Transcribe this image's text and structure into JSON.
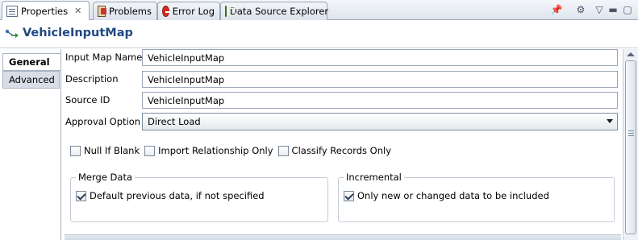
{
  "tabs": [
    {
      "label": "Properties",
      "icon": "properties-icon",
      "active": true
    },
    {
      "label": "Problems",
      "icon": "problems-icon",
      "active": false
    },
    {
      "label": "Error Log",
      "icon": "error-log-icon",
      "active": false
    },
    {
      "label": "Data Source Explorer",
      "icon": "data-source-explorer-icon",
      "active": false
    }
  ],
  "toolbar": {
    "pin_icon": "pin-icon",
    "sync_icon": "sync-icon",
    "menu_icon": "view-menu-icon",
    "minimize_icon": "minimize-icon",
    "maximize_icon": "maximize-icon"
  },
  "header": {
    "title": "VehicleInputMap",
    "icon": "input-map-icon"
  },
  "side_tabs": [
    {
      "label": "General",
      "active": true
    },
    {
      "label": "Advanced",
      "active": false
    }
  ],
  "form": {
    "input_map_name": {
      "label": "Input Map Name",
      "value": "VehicleInputMap"
    },
    "description": {
      "label": "Description",
      "value": "VehicleInputMap"
    },
    "source_id": {
      "label": "Source ID",
      "value": "VehicleInputMap"
    },
    "approval_option": {
      "label": "Approval Option",
      "value": "Direct Load"
    },
    "checkboxes": [
      {
        "label": "Null If Blank",
        "checked": false
      },
      {
        "label": "Import Relationship Only",
        "checked": false
      },
      {
        "label": "Classify Records Only",
        "checked": false
      }
    ],
    "merge_data": {
      "title": "Merge Data",
      "checkbox": {
        "label": "Default previous data, if not specified",
        "checked": true
      }
    },
    "incremental": {
      "title": "Incremental",
      "checkbox": {
        "label": "Only new or changed data to be included",
        "checked": true
      }
    }
  },
  "colors": {
    "title": "#1f4a82",
    "border": "#9ca7b6",
    "tab_inactive": "#d8dee7"
  }
}
